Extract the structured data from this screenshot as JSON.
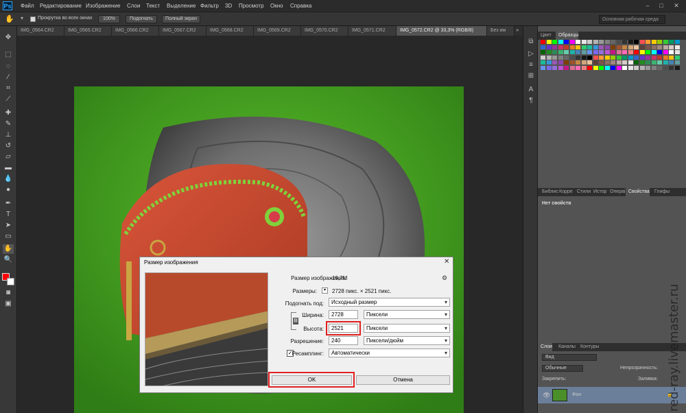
{
  "app": {
    "logo": "Ps"
  },
  "menu": [
    "Файл",
    "Редактирование",
    "Изображение",
    "Слои",
    "Текст",
    "Выделение",
    "Фильтр",
    "3D",
    "Просмотр",
    "Окно",
    "Справка"
  ],
  "options": {
    "scroll_all": "Прокрутка во всех окнах",
    "zoom100": "100%",
    "fit": "Подогнать",
    "fullscreen": "Полный экран",
    "workspace": "Основная рабочая среда"
  },
  "tabs": [
    "IMG_0564.CR2",
    "IMG_0565.CR2",
    "IMG_0566.CR2",
    "IMG_0567.CR2",
    "IMG_0568.CR2",
    "IMG_0569.CR2",
    "IMG_0570.CR2",
    "IMG_0571.CR2",
    "IMG_0572.CR2 @ 33,3% (RGB/8)",
    "Без им"
  ],
  "panels": {
    "color_tabs": [
      "Цвет",
      "Образцы"
    ],
    "mid_tabs": [
      "Библис",
      "Корре",
      "Стили",
      "Истор",
      "Операі",
      "Свойства",
      "Глифы"
    ],
    "no_props": "Нет свойств",
    "layer_tabs": [
      "Слои",
      "Каналы",
      "Контуры"
    ],
    "kind": "Вид",
    "blend": "Обычные",
    "opacity_label": "Непрозрачность:",
    "lock_label": "Закрепить:",
    "fill_label": "Заливка:",
    "layer_name": "Фон"
  },
  "swatch_colors": [
    "#ff0000",
    "#ffff00",
    "#00ff00",
    "#00ffff",
    "#0000ff",
    "#ff00ff",
    "#ffffff",
    "#e6e6e6",
    "#cccccc",
    "#b3b3b3",
    "#999999",
    "#808080",
    "#666666",
    "#4d4d4d",
    "#333333",
    "#1a1a1a",
    "#000000",
    "#ff5050",
    "#ff9933",
    "#ffcc00",
    "#99cc00",
    "#33cc33",
    "#009966",
    "#0099cc",
    "#3366cc",
    "#6633cc",
    "#993399",
    "#cc3366",
    "#c0392b",
    "#e67e22",
    "#f1c40f",
    "#2ecc71",
    "#1abc9c",
    "#3498db",
    "#9b59b6",
    "#8e44ad",
    "#7f3f00",
    "#a0522d",
    "#c68642",
    "#d2a679",
    "#e8c39e",
    "#5d4037",
    "#795548",
    "#8d6e63",
    "#a1887f",
    "#bcaaa4",
    "#d7ccc8",
    "#efebe9",
    "#006400",
    "#228b22",
    "#2e8b57",
    "#3cb371",
    "#66cdaa",
    "#20b2aa",
    "#4682b4",
    "#5f9ea0",
    "#6495ed",
    "#7b68ee",
    "#9370db",
    "#ba55d3",
    "#c71585",
    "#db7093",
    "#ff69b4",
    "#f08080"
  ],
  "dialog": {
    "title": "Размер изображения",
    "size_label": "Размер изображения:",
    "size_value": "19,7M",
    "dims_label": "Размеры:",
    "dims_value": "2728 пикс.  ×  2521 пикс.",
    "fit_label": "Подогнать под:",
    "fit_value": "Исходный размер",
    "width_label": "Ширина:",
    "width_value": "2728",
    "width_unit": "Пиксели",
    "height_label": "Высота:",
    "height_value": "2521",
    "height_unit": "Пиксели",
    "res_label": "Разрешение:",
    "res_value": "240",
    "res_unit": "Пиксели/дюйм",
    "resample_label": "Ресамплинг:",
    "resample_value": "Автоматически",
    "ok": "OK",
    "cancel": "Отмена"
  },
  "watermark": "red-ray.livemaster.ru"
}
